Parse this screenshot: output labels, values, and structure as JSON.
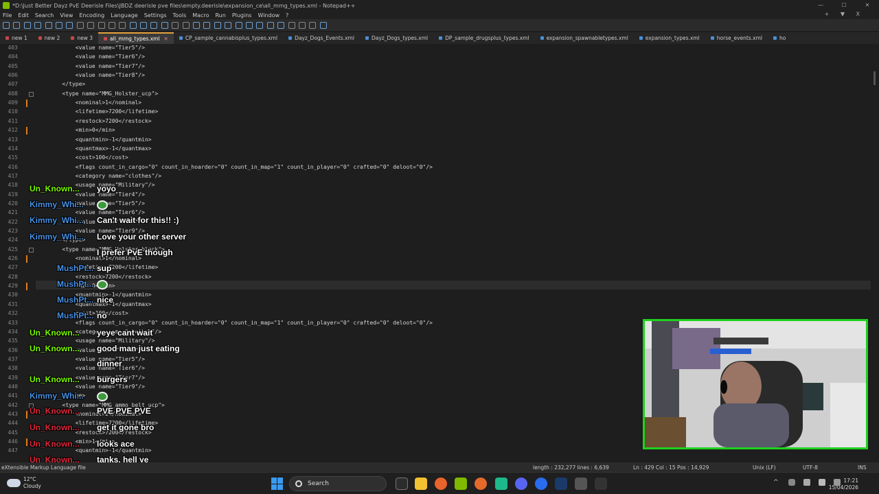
{
  "window": {
    "title": "*D:\\Just Better Dayz PvE Deerisle Files\\JBDZ deerisle pve files\\empty.deerisle\\expansion_ce\\all_mmg_types.xml - Notepad++",
    "menu": [
      "File",
      "Edit",
      "Search",
      "View",
      "Encoding",
      "Language",
      "Settings",
      "Tools",
      "Macro",
      "Run",
      "Plugins",
      "Window",
      "?"
    ],
    "menu_right": [
      "+",
      "▼",
      "X"
    ]
  },
  "tabs": [
    {
      "label": "new 1",
      "active": false
    },
    {
      "label": "new 2",
      "active": false
    },
    {
      "label": "new 3",
      "active": false
    },
    {
      "label": "all_mmg_types.xml",
      "active": true
    },
    {
      "label": "CP_sample_cannabisplus_types.xml",
      "active": false
    },
    {
      "label": "Dayz_Dogs_Events.xml",
      "active": false
    },
    {
      "label": "Dayz_Dogs_types.xml",
      "active": false
    },
    {
      "label": "DP_sample_drugsplus_types.xml",
      "active": false
    },
    {
      "label": "expansion_spawnabletypes.xml",
      "active": false
    },
    {
      "label": "expansion_types.xml",
      "active": false
    },
    {
      "label": "horse_events.xml",
      "active": false
    },
    {
      "label": "ho",
      "active": false
    }
  ],
  "editor": {
    "lines": [
      {
        "n": "403",
        "text": "            <value name=\"Tier5\"/>"
      },
      {
        "n": "404",
        "text": "            <value name=\"Tier6\"/>"
      },
      {
        "n": "405",
        "text": "            <value name=\"Tier7\"/>"
      },
      {
        "n": "406",
        "text": "            <value name=\"Tier8\"/>"
      },
      {
        "n": "407",
        "text": "        </type>"
      },
      {
        "n": "408",
        "text": "        <type name=\"MMG_Holster_ucp\">"
      },
      {
        "n": "409",
        "text": "            <nominal>1</nominal>"
      },
      {
        "n": "410",
        "text": "            <lifetime>7200</lifetime>"
      },
      {
        "n": "411",
        "text": "            <restock>7200</restock>"
      },
      {
        "n": "412",
        "text": "            <min>0</min>"
      },
      {
        "n": "413",
        "text": "            <quantmin>-1</quantmin>"
      },
      {
        "n": "414",
        "text": "            <quantmax>-1</quantmax>"
      },
      {
        "n": "415",
        "text": "            <cost>100</cost>"
      },
      {
        "n": "416",
        "text": "            <flags count_in_cargo=\"0\" count_in_hoarder=\"0\" count_in_map=\"1\" count_in_player=\"0\" crafted=\"0\" deloot=\"0\"/>"
      },
      {
        "n": "417",
        "text": "            <category name=\"clothes\"/>"
      },
      {
        "n": "418",
        "text": "            <usage name=\"Military\"/>"
      },
      {
        "n": "419",
        "text": "            <value name=\"Tier4\"/>"
      },
      {
        "n": "420",
        "text": "            <value name=\"Tier5\"/>"
      },
      {
        "n": "421",
        "text": "            <value name=\"Tier6\"/>"
      },
      {
        "n": "422",
        "text": "            <value name=\"Tier7\"/>"
      },
      {
        "n": "423",
        "text": "            <value name=\"Tier9\"/>"
      },
      {
        "n": "424",
        "text": "        </type>"
      },
      {
        "n": "425",
        "text": "        <type name=\"MMG_Holster_black\">"
      },
      {
        "n": "426",
        "text": "            <nominal>1</nominal>"
      },
      {
        "n": "427",
        "text": "            <lifetime>7200</lifetime>"
      },
      {
        "n": "428",
        "text": "            <restock>7200</restock>"
      },
      {
        "n": "429",
        "text": "            <min>0</min>"
      },
      {
        "n": "430",
        "text": "            <quantmin>-1</quantmin>"
      },
      {
        "n": "431",
        "text": "            <quantmax>-1</quantmax>"
      },
      {
        "n": "432",
        "text": "            <cost>100</cost>"
      },
      {
        "n": "433",
        "text": "            <flags count_in_cargo=\"0\" count_in_hoarder=\"0\" count_in_map=\"1\" count_in_player=\"0\" crafted=\"0\" deloot=\"0\"/>"
      },
      {
        "n": "434",
        "text": "            <category name=\"clothes\"/>"
      },
      {
        "n": "435",
        "text": "            <usage name=\"Military\"/>"
      },
      {
        "n": "436",
        "text": "            <value name=\"Tier4\"/>"
      },
      {
        "n": "437",
        "text": "            <value name=\"Tier5\"/>"
      },
      {
        "n": "438",
        "text": "            <value name=\"Tier6\"/>"
      },
      {
        "n": "439",
        "text": "            <value name=\"Tier7\"/>"
      },
      {
        "n": "440",
        "text": "            <value name=\"Tier9\"/>"
      },
      {
        "n": "441",
        "text": "        </type>"
      },
      {
        "n": "442",
        "text": "        <type name=\"MMG_ammo_belt_ucp\">"
      },
      {
        "n": "443",
        "text": "            <nominal>2</nominal>"
      },
      {
        "n": "444",
        "text": "            <lifetime>7200</lifetime>"
      },
      {
        "n": "445",
        "text": "            <restock>7200</restock>"
      },
      {
        "n": "446",
        "text": "            <min>1</min>"
      },
      {
        "n": "447",
        "text": "            <quantmin>-1</quantmin>"
      }
    ]
  },
  "chat": [
    {
      "user": "Un_Known...",
      "message": "yoyo",
      "color": "#7CFC00"
    },
    {
      "user": "Kimmy_Whi...",
      "message": "",
      "color": "#4a90e2",
      "emote": "green-face-emote"
    },
    {
      "user": "Kimmy_Whi...",
      "message": "Can't wait for this!! :)",
      "color": "#4a90e2"
    },
    {
      "user": "Kimmy_Whi...",
      "message": "Love your other server",
      "color": "#4a90e2"
    },
    {
      "user": "",
      "message": "I prefer PvE though",
      "color": "#4a90e2"
    },
    {
      "user": "MushPt...",
      "message": "sup",
      "color": "#4a90e2"
    },
    {
      "user": "MushPt...",
      "message": "",
      "color": "#4a90e2",
      "emote": "green-face-emote"
    },
    {
      "user": "MushPt...",
      "message": "nice",
      "color": "#4a90e2"
    },
    {
      "user": "MushPt...",
      "message": "no",
      "color": "#4a90e2"
    },
    {
      "user": "Un_Known...",
      "message": "yeye cant wait",
      "color": "#7CFC00"
    },
    {
      "user": "Un_Known...",
      "message": "good man just eating",
      "color": "#7CFC00"
    },
    {
      "user": "",
      "message": "dinner",
      "color": "#7CFC00"
    },
    {
      "user": "Un_Known...",
      "message": "burgers",
      "color": "#7CFC00"
    },
    {
      "user": "Kimmy_Whi...",
      "message": "",
      "color": "#4a90e2",
      "emote": "green-face-emote"
    },
    {
      "user": "Un_Known...",
      "message": "PVE PVE PVE",
      "color": "#e0283c"
    },
    {
      "user": "Un_Known...",
      "message": "get it gone bro",
      "color": "#e0283c"
    },
    {
      "user": "Un_Known...",
      "message": "looks ace",
      "color": "#e0283c"
    },
    {
      "user": "Un_Known...",
      "message": "tanks, hell ye",
      "color": "#e0283c"
    }
  ],
  "statusbar": {
    "filetype": "eXtensible Markup Language file",
    "length": "length : 232,277    lines : 6,639",
    "position": "Ln : 429    Col : 15    Pos : 14,929",
    "eol": "Unix (LF)",
    "encoding": "UTF-8",
    "mode": "INS"
  },
  "taskbar": {
    "weather_temp": "12°C",
    "weather_desc": "Cloudy",
    "search_label": "Search",
    "time": "17:21",
    "date": "15/04/2026"
  },
  "colors": {
    "accent": "#e6a23c",
    "webcam_border": "#1ed21e",
    "windows_blue": "#3a9bf0"
  }
}
